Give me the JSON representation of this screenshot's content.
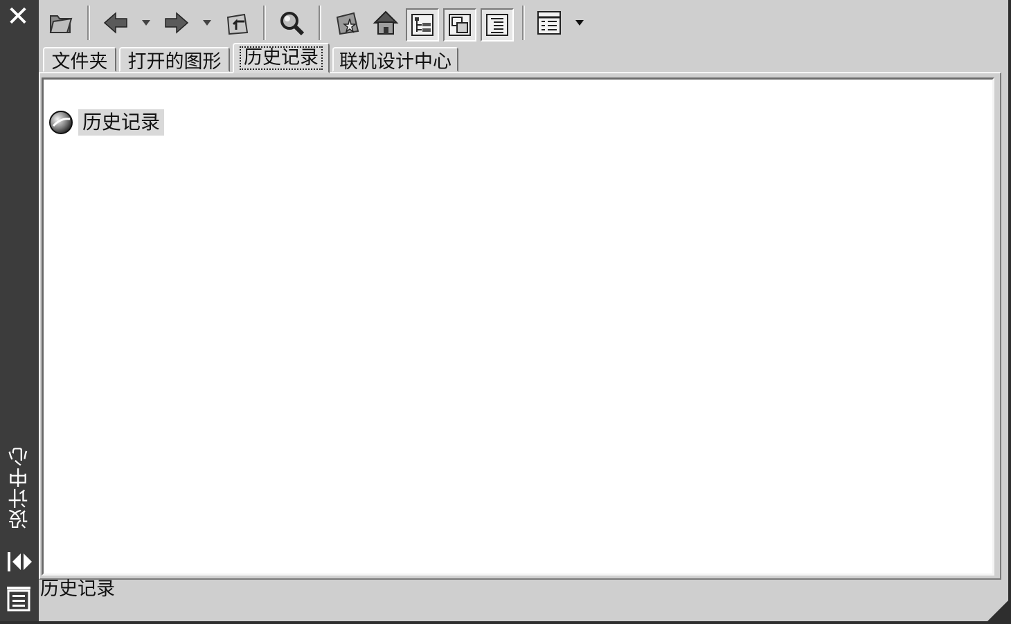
{
  "window": {
    "title": "设计中心",
    "close_icon": "close-icon",
    "autohide_icon": "autohide-icon",
    "properties_icon": "properties-icon"
  },
  "toolbar": {
    "buttons": [
      {
        "name": "load-button",
        "icon": "folder-load-icon"
      },
      {
        "name": "back-button",
        "icon": "arrow-left-icon"
      },
      {
        "name": "forward-button",
        "icon": "arrow-right-icon"
      },
      {
        "name": "up-button",
        "icon": "folder-up-icon"
      },
      {
        "name": "search-button",
        "icon": "search-icon"
      },
      {
        "name": "favorites-button",
        "icon": "favorites-icon"
      },
      {
        "name": "home-button",
        "icon": "home-icon"
      },
      {
        "name": "tree-toggle-button",
        "icon": "tree-view-icon"
      },
      {
        "name": "preview-button",
        "icon": "preview-icon"
      },
      {
        "name": "description-button",
        "icon": "description-icon"
      },
      {
        "name": "views-button",
        "icon": "views-icon"
      }
    ]
  },
  "tabs": [
    {
      "label": "文件夹",
      "active": false
    },
    {
      "label": "打开的图形",
      "active": false
    },
    {
      "label": "历史记录",
      "active": true
    },
    {
      "label": "联机设计中心",
      "active": false
    }
  ],
  "content": {
    "items": [
      {
        "label": "历史记录",
        "icon": "globe-icon",
        "selected": true
      }
    ]
  },
  "status": {
    "text": "历史记录"
  },
  "colors": {
    "panel": "#cfcfcf",
    "side_strip": "#3c3c3c",
    "content_bg": "#ffffff",
    "selection": "#d9d9d9"
  }
}
